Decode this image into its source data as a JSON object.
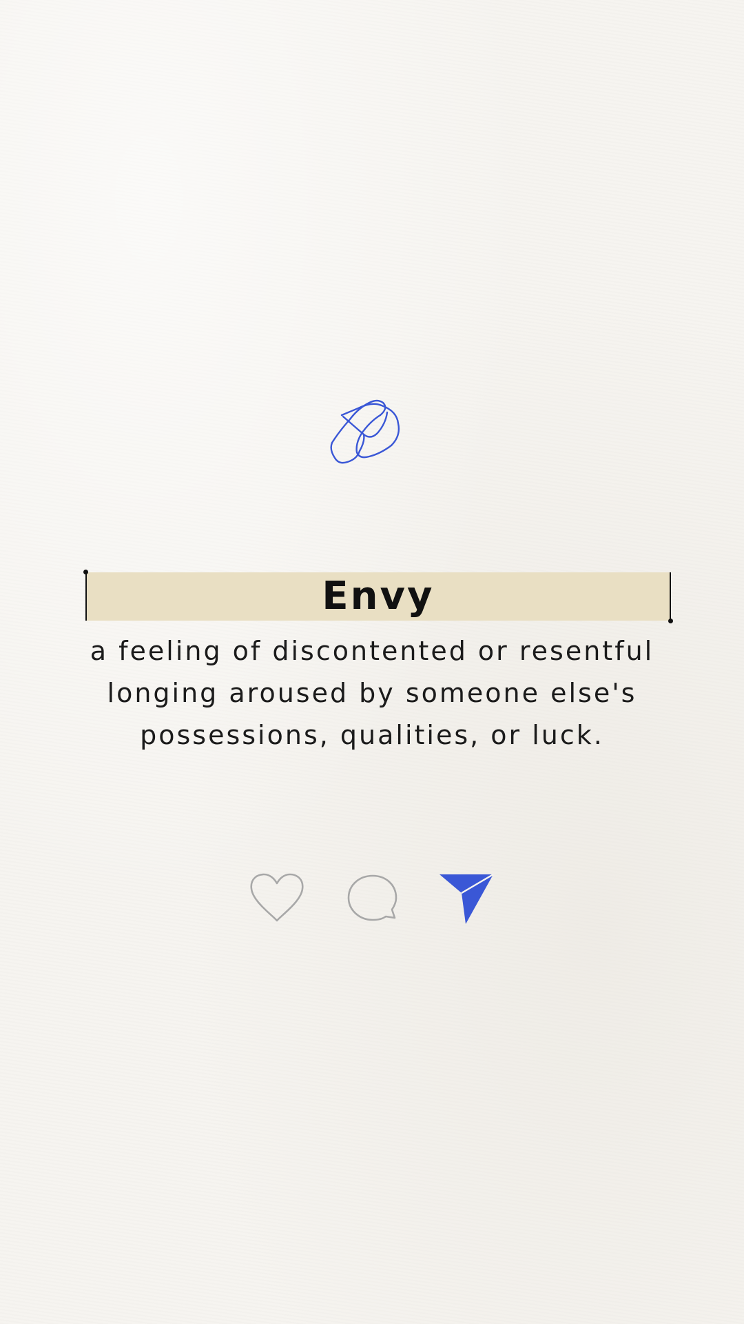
{
  "word": {
    "title": "Envy",
    "definition_lines": [
      "a feeling of discontented or resentful",
      "longing aroused by someone else's",
      "possessions, qualities, or luck."
    ]
  },
  "actions": [
    {
      "icon": "heart-icon"
    },
    {
      "icon": "comment-icon"
    },
    {
      "icon": "paper-plane-icon"
    }
  ],
  "colors": {
    "background": "#f6f4f0",
    "highlight": "#e9dfc3",
    "accent": "#3a57d6",
    "icon_outline": "#a8a8a8",
    "text": "#111111"
  }
}
